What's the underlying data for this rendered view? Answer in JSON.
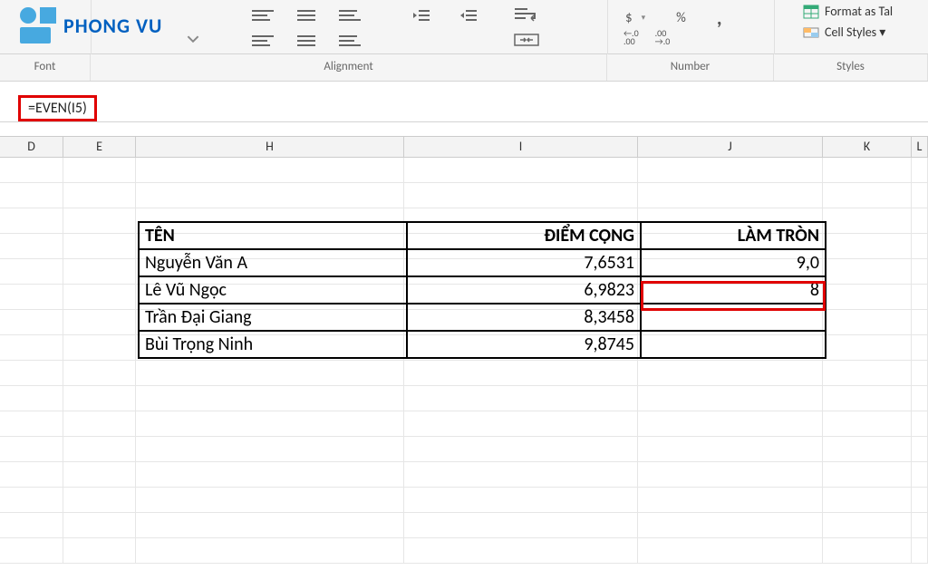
{
  "logo": {
    "text": "PHONG VU"
  },
  "ribbon": {
    "groups": {
      "font": "Font",
      "alignment": "Alignment",
      "number": "Number",
      "styles": "Styles"
    },
    "number_symbols": {
      "accounting": "$",
      "percent": "%",
      "comma": ",",
      "sep": "▾"
    },
    "decimal": {
      "inc": ".0  .00",
      "dec": ".00  .0",
      "inc_arrow": "←",
      "dec_arrow": "→"
    },
    "styles": {
      "format_table": "Format as Tal",
      "cell_styles": "Cell Styles ▾",
      "fmt_dd": "▾"
    }
  },
  "formula": "=EVEN(I5)",
  "columns": [
    "D",
    "E",
    "H",
    "I",
    "J",
    "K",
    "L"
  ],
  "table": {
    "headers": {
      "name": "TÊN",
      "score": "ĐIỂM CỘNG",
      "round": "LÀM TRÒN"
    },
    "rows": [
      {
        "name": "Nguyễn Văn A",
        "score": "7,6531",
        "round": "9,0"
      },
      {
        "name": "Lê Vũ Ngọc",
        "score": "6,9823",
        "round": "8"
      },
      {
        "name": "Trần Đại Giang",
        "score": "8,3458",
        "round": ""
      },
      {
        "name": "Bùi Trọng Ninh",
        "score": "9,8745",
        "round": ""
      }
    ]
  }
}
